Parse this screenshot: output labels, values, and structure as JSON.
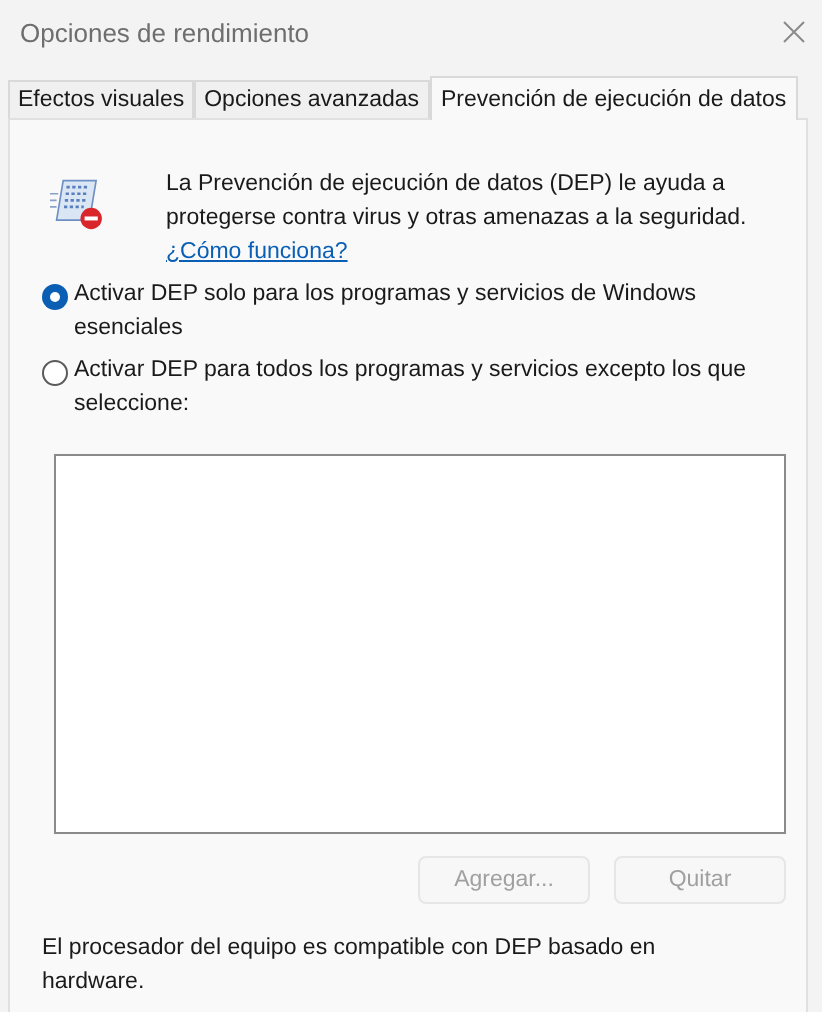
{
  "window": {
    "title": "Opciones de rendimiento"
  },
  "tabs": [
    {
      "label": "Efectos visuales",
      "selected": false
    },
    {
      "label": "Opciones avanzadas",
      "selected": false
    },
    {
      "label": "Prevención de ejecución de datos",
      "selected": true
    }
  ],
  "dep": {
    "description": "La Prevención de ejecución de datos (DEP) le ayuda a protegerse contra virus y otras amenazas a la seguridad.",
    "link": "¿Cómo funciona?",
    "options": [
      {
        "label": "Activar DEP solo para los programas y servicios de Windows esenciales",
        "selected": true
      },
      {
        "label": "Activar DEP para todos los programas y servicios excepto los que seleccione:",
        "selected": false
      }
    ],
    "buttons": [
      {
        "label": "Agregar...",
        "disabled": true
      },
      {
        "label": "Quitar",
        "disabled": true
      }
    ],
    "footer": "El procesador del equipo es compatible con DEP basado en hardware."
  }
}
